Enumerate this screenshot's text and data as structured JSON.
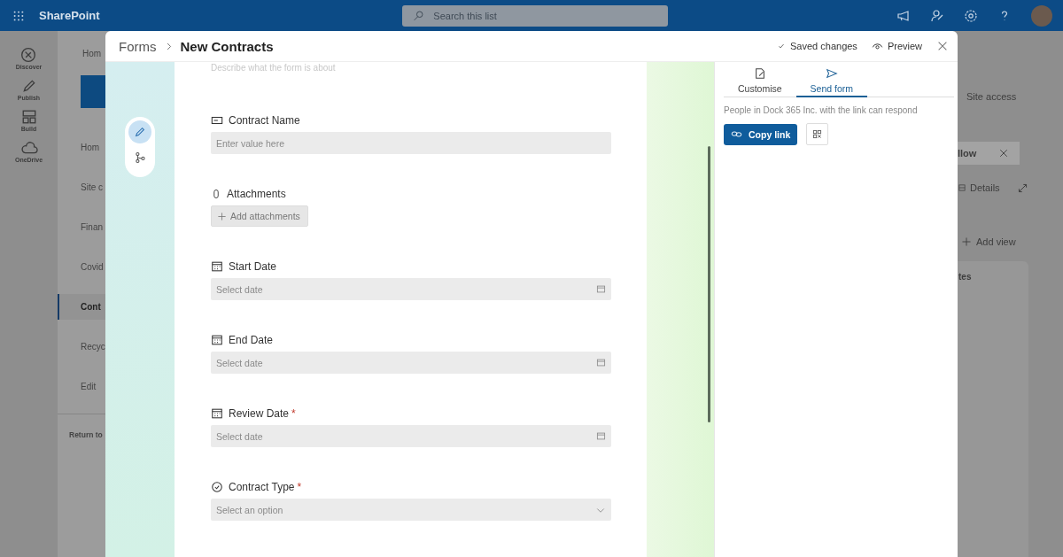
{
  "top_bar": {
    "app_name": "SharePoint",
    "search": {
      "placeholder": "Search this list"
    }
  },
  "rail": [
    {
      "label": "Discover",
      "kind": "discover"
    },
    {
      "label": "Publish",
      "kind": "publish"
    },
    {
      "label": "Build",
      "kind": "build"
    },
    {
      "label": "OneDrive",
      "kind": "onedrive"
    }
  ],
  "site_nav": {
    "header": "Hom",
    "items": [
      {
        "label": "Hom",
        "selected": false
      },
      {
        "label": "Site c",
        "selected": false
      },
      {
        "label": "Finan",
        "selected": false
      },
      {
        "label": "Covid",
        "selected": false
      },
      {
        "label": "Cont",
        "selected": true
      },
      {
        "label": "Recyc",
        "selected": false
      },
      {
        "label": "Edit",
        "selected": false
      }
    ],
    "footer": "Return to"
  },
  "background_right": {
    "site_access": "Site access",
    "follow": "llow",
    "details": "Details",
    "add_view": "Add view",
    "card_title": "tes"
  },
  "modal": {
    "breadcrumb": [
      "Forms",
      "New Contracts"
    ],
    "status": "Saved changes",
    "preview": "Preview",
    "tools": [
      {
        "kind": "edit",
        "selected": true
      },
      {
        "kind": "branch",
        "selected": false
      }
    ],
    "description_placeholder": "Describe what the form is about",
    "fields": [
      {
        "kind": "text",
        "label": "Contract Name",
        "placeholder": "Enter value here"
      },
      {
        "kind": "attachment",
        "label": "Attachments",
        "button": "Add attachments"
      },
      {
        "kind": "date",
        "label": "Start Date",
        "placeholder": "Select date"
      },
      {
        "kind": "date",
        "label": "End Date",
        "placeholder": "Select date"
      },
      {
        "kind": "date",
        "label": "Review Date",
        "required_mark": "*",
        "placeholder": "Select date"
      },
      {
        "kind": "choice",
        "label": "Contract Type",
        "required_mark": "*",
        "placeholder": "Select an option"
      }
    ],
    "panel_tabs": [
      {
        "label": "Customise",
        "kind": "customise",
        "selected": false
      },
      {
        "label": "Send form",
        "kind": "send",
        "selected": true
      }
    ],
    "share_note": "People in Dock 365 Inc. with the link can respond",
    "copy_link": "Copy link"
  }
}
